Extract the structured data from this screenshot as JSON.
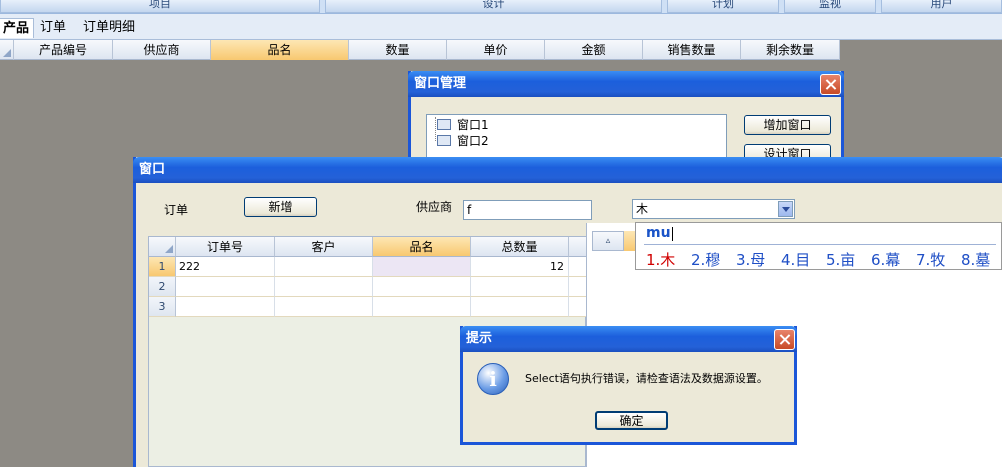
{
  "menu": {
    "items": [
      "项目",
      "设计",
      "计划",
      "监视",
      "用户"
    ]
  },
  "tabs": [
    "产品",
    "订单",
    "订单明细"
  ],
  "product_grid": {
    "columns": [
      "产品编号",
      "供应商",
      "品名",
      "数量",
      "单价",
      "金额",
      "销售数量",
      "剩余数量"
    ]
  },
  "window_manager": {
    "title": "窗口管理",
    "tree_items": [
      "窗口1",
      "窗口2"
    ],
    "add_button": "增加窗口",
    "design_button": "设计窗口"
  },
  "order_window": {
    "title": "窗口",
    "order_label": "订单",
    "new_button": "新增",
    "supplier_label": "供应商",
    "supplier_value": "f",
    "combo_value": "木",
    "grid_columns": [
      "订单号",
      "客户",
      "品名",
      "总数量"
    ],
    "rows": [
      {
        "num": "1",
        "order_no": "222",
        "customer": "",
        "name": "",
        "qty": "12"
      },
      {
        "num": "2",
        "order_no": "",
        "customer": "",
        "name": "",
        "qty": ""
      },
      {
        "num": "3",
        "order_no": "",
        "customer": "",
        "name": "",
        "qty": ""
      }
    ]
  },
  "ime": {
    "composition": "mu",
    "candidates": [
      "1.木",
      "2.穆",
      "3.母",
      "4.目",
      "5.亩",
      "6.幕",
      "7.牧",
      "8.墓"
    ]
  },
  "alert": {
    "title": "提示",
    "message": "Select语句执行错误，请检查语法及数据源设置。",
    "ok_button": "确定"
  },
  "colors": {
    "title_bar": "#1c5fdc",
    "selected_header": "#f8c870",
    "desktop": "#8d8a84"
  }
}
